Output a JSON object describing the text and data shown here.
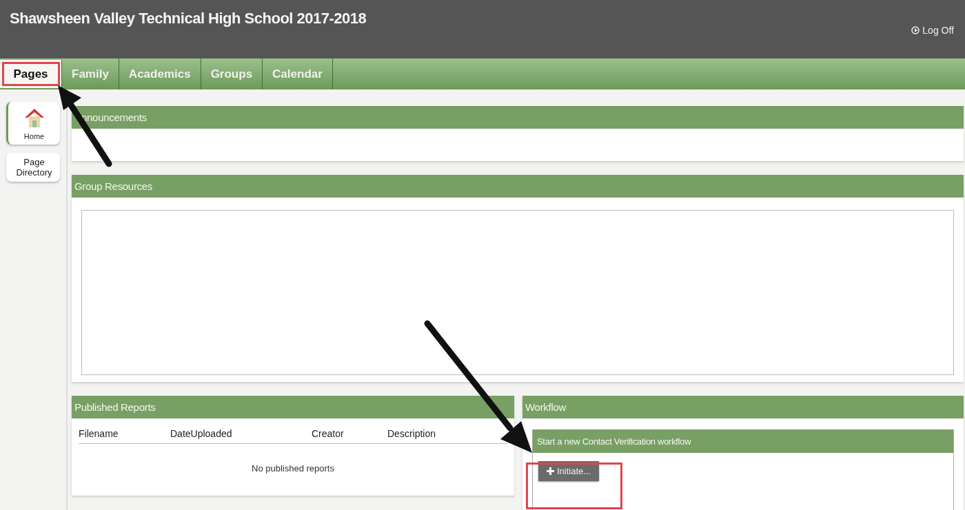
{
  "header": {
    "title": "Shawsheen Valley Technical High School 2017-2018",
    "log_off": "Log Off"
  },
  "tabs": [
    {
      "label": "Pages",
      "selected": true
    },
    {
      "label": "Family",
      "selected": false
    },
    {
      "label": "Academics",
      "selected": false
    },
    {
      "label": "Groups",
      "selected": false
    },
    {
      "label": "Calendar",
      "selected": false
    }
  ],
  "sidebar": {
    "items": [
      {
        "label": "Home",
        "selected": true,
        "kind": "icon"
      },
      {
        "label": "Page Directory",
        "selected": false,
        "kind": "text"
      }
    ]
  },
  "announcements": {
    "title": "nnouncements"
  },
  "group_resources": {
    "title": "Group Resources"
  },
  "published_reports": {
    "title": "Published Reports",
    "columns": [
      "Filename",
      "DateUploaded",
      "Creator",
      "Description"
    ],
    "empty_message": "No published reports"
  },
  "workflow": {
    "title": "Workflow",
    "subtitle": "Start a new Contact Verification workflow",
    "button": "Initiate..."
  }
}
